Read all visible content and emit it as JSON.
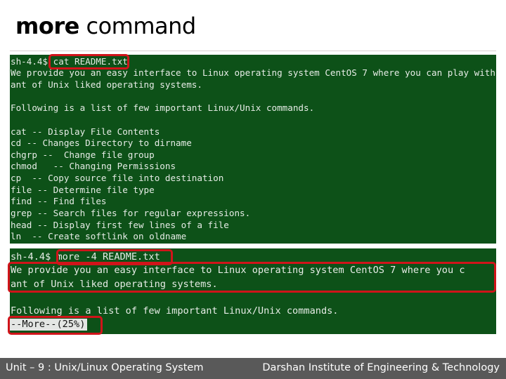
{
  "slide": {
    "title_bold": "more",
    "title_rest": " command"
  },
  "terminal1": {
    "prompt": "sh-4.4$ ",
    "command": "cat README.txt",
    "lines": [
      "We provide you an easy interface to Linux operating system CentOS 7 where you can play with",
      "ant of Unix liked operating systems.",
      "",
      "Following is a list of few important Linux/Unix commands.",
      "",
      "cat -- Display File Contents",
      "cd -- Changes Directory to dirname",
      "chgrp --  Change file group",
      "chmod   -- Changing Permissions",
      "cp  -- Copy source file into destination",
      "file -- Determine file type",
      "find -- Find files",
      "grep -- Search files for regular expressions.",
      "head -- Display first few lines of a file",
      "ln  -- Create softlink on oldname"
    ]
  },
  "terminal2": {
    "prompt": "sh-4.4$ ",
    "command": "more -4 README.txt",
    "lines": [
      "We provide you an easy interface to Linux operating system CentOS 7 where you c",
      "ant of Unix liked operating systems.",
      "",
      "Following is a list of few important Linux/Unix commands."
    ],
    "more_prompt": "--More--(25%)",
    "progress_percent": 25
  },
  "footer": {
    "left": "Unit – 9 : Unix/Linux Operating System",
    "right": "Darshan Institute of Engineering & Technology"
  },
  "colors": {
    "terminal_bg": "#0d5118",
    "terminal_text": "#e6ece6",
    "highlight": "#d0141a",
    "footer_bg": "#595959"
  }
}
